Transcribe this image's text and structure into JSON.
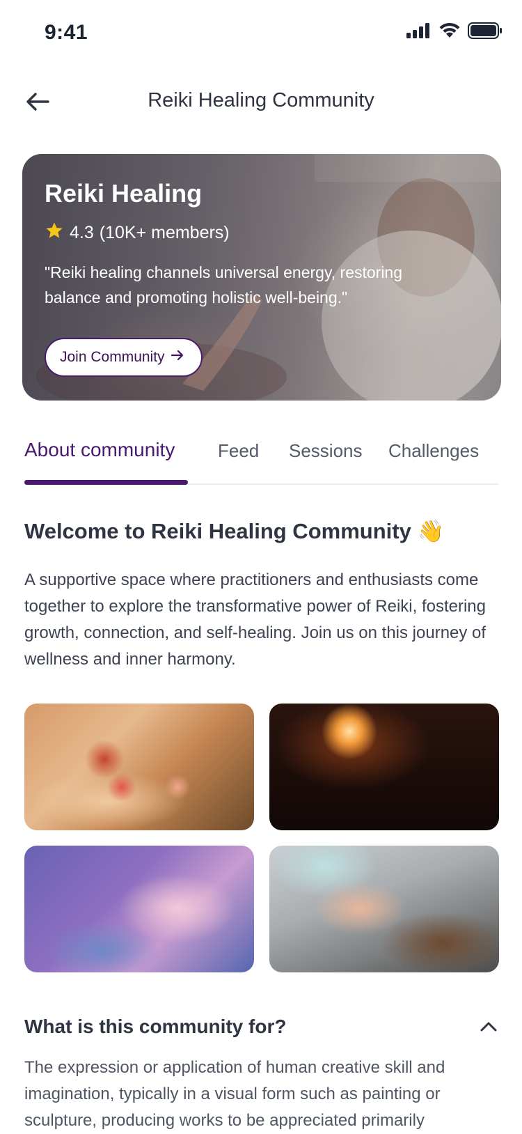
{
  "status_bar": {
    "time": "9:41",
    "icons": [
      "signal-icon",
      "wifi-icon",
      "battery-icon"
    ]
  },
  "header": {
    "title": "Reiki Healing Community",
    "back_icon": "arrow-left-icon"
  },
  "hero": {
    "title": "Reiki Healing",
    "rating": "4.3",
    "members": "(10K+ members)",
    "quote": "\"Reiki healing channels universal energy, restoring balance and promoting holistic well-being.\"",
    "join_label": "Join Community",
    "join_icon": "arrow-right-icon",
    "star_color": "#f5c518"
  },
  "tabs": [
    {
      "label": "About community",
      "active": true
    },
    {
      "label": "Feed",
      "active": false
    },
    {
      "label": "Sessions",
      "active": false
    },
    {
      "label": "Challenges",
      "active": false
    }
  ],
  "welcome": {
    "title": "Welcome to Reiki Healing Community",
    "emoji": "👋",
    "body": "A supportive space where practitioners and enthusiasts come together to explore the transformative power of Reiki, fostering growth, connection, and self-healing. Join us on this journey of wellness and inner harmony."
  },
  "faq": {
    "title": "What is this community for?",
    "toggle_icon": "chevron-up-icon",
    "body": "The expression or application of human creative skill and imagination, typically in a visual form such as painting or sculpture, producing works to be appreciated primarily"
  },
  "colors": {
    "accent": "#4a1870",
    "text": "#2e3441"
  }
}
